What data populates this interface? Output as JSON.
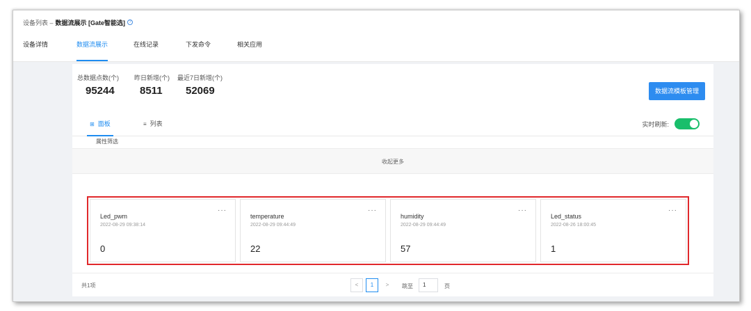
{
  "header": {
    "breadcrumb_parent": "设备列表 –",
    "breadcrumb_current": "数据流展示 [Gate智能选]",
    "info_icon_glyph": "?"
  },
  "nav": {
    "tabs": [
      {
        "label": "设备详情"
      },
      {
        "label": "数据流展示"
      },
      {
        "label": "在线记录"
      },
      {
        "label": "下发命令"
      },
      {
        "label": "相关应用"
      }
    ]
  },
  "stats": {
    "items": [
      {
        "label": "总数据点数(个)",
        "value": "95244"
      },
      {
        "label": "昨日新增(个)",
        "value": "8511"
      },
      {
        "label": "最近7日新增(个)",
        "value": "52069"
      }
    ],
    "action_button": "数据流模板管理"
  },
  "panel": {
    "view_tabs": [
      {
        "icon": "grid-icon",
        "glyph": "⊞",
        "label": "面板"
      },
      {
        "icon": "list-icon",
        "glyph": "≡",
        "label": "列表"
      }
    ],
    "auto_refresh_label": "实时刷新:",
    "auto_refresh_on": true,
    "filter_label": "属性筛选",
    "collapse_label": "收起更多",
    "cards": [
      {
        "name": "Led_pwm",
        "time": "2022-08-29 09:38:14",
        "value": "0",
        "more": "···"
      },
      {
        "name": "temperature",
        "time": "2022-08-29 09:44:49",
        "value": "22",
        "more": "···"
      },
      {
        "name": "humidity",
        "time": "2022-08-29 09:44:49",
        "value": "57",
        "more": "···"
      },
      {
        "name": "Led_status",
        "time": "2022-08-26 18:00:45",
        "value": "1",
        "more": "···"
      }
    ],
    "pagination": {
      "total": "共1项",
      "prev": "<",
      "current": "1",
      "next": ">",
      "goto_label": "跳至",
      "goto_value": "1",
      "page_suffix": "页"
    }
  },
  "colors": {
    "accent": "#2d8cf0",
    "toggle_on": "#19be6b",
    "highlight_border": "#e0282b"
  }
}
